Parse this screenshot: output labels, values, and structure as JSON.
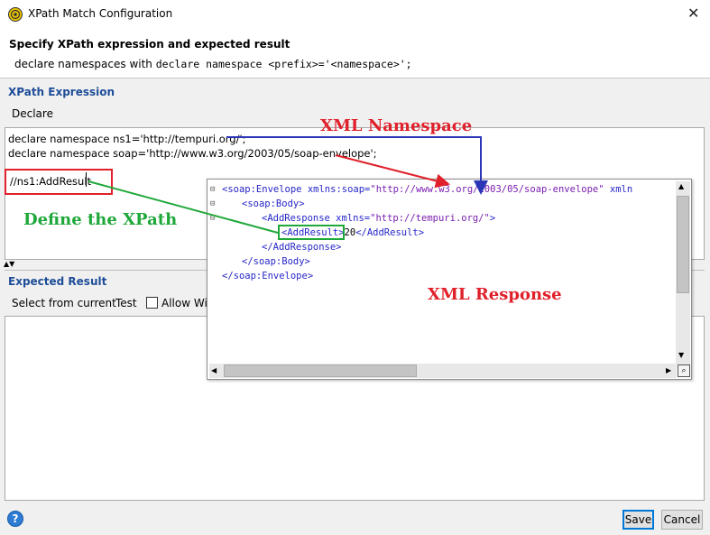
{
  "window": {
    "title": "XPath Match Configuration",
    "close_glyph": "✕"
  },
  "header": {
    "title": "Specify XPath expression and expected result",
    "desc_prefix": "declare namespaces with ",
    "desc_code": "declare namespace <prefix>='<namespace>';"
  },
  "xpath": {
    "section_label": "XPath Expression",
    "declare_label": "Declare",
    "lines": [
      "declare namespace ns1='http://tempuri.org/';",
      "declare namespace soap='http://www.w3.org/2003/05/soap-envelope';",
      "//ns1:AddResult"
    ]
  },
  "expected": {
    "section_label": "Expected Result",
    "toolbar": {
      "select_label": "Select from current",
      "test_label": "Test",
      "allow_label": "Allow Wil"
    }
  },
  "xml_panel": {
    "lines": [
      {
        "gutter": "⊟",
        "indent": 0,
        "parts": [
          [
            "tag",
            "<soap:Envelope"
          ],
          [
            "attr",
            " xmlns:soap="
          ],
          [
            "val",
            "\"http://www.w3.org/2003/05/soap-envelope\""
          ],
          [
            "attr",
            " xmln"
          ]
        ]
      },
      {
        "gutter": "⊟",
        "indent": 1,
        "parts": [
          [
            "tag",
            "<soap:Body>"
          ]
        ]
      },
      {
        "gutter": "⊟",
        "indent": 2,
        "parts": [
          [
            "tag",
            "<AddResponse"
          ],
          [
            "attr",
            " xmlns="
          ],
          [
            "val",
            "\"http://tempuri.org/\""
          ],
          [
            "tag",
            ">"
          ]
        ]
      },
      {
        "gutter": "",
        "indent": 3,
        "parts": [
          [
            "tag",
            "<AddResult>"
          ],
          [
            "plain",
            "20"
          ],
          [
            "tag",
            "</AddResult>"
          ]
        ]
      },
      {
        "gutter": "",
        "indent": 2,
        "parts": [
          [
            "tag",
            "</AddResponse>"
          ]
        ]
      },
      {
        "gutter": "",
        "indent": 1,
        "parts": [
          [
            "tag",
            "</soap:Body>"
          ]
        ]
      },
      {
        "gutter": "",
        "indent": 0,
        "parts": [
          [
            "tag",
            "</soap:Envelope>"
          ]
        ]
      }
    ]
  },
  "annotations": {
    "namespace": "XML Namespace",
    "define": "Define the XPath",
    "response": "XML Response"
  },
  "buttons": {
    "save": "Save",
    "cancel": "Cancel",
    "help": "?"
  },
  "colors": {
    "annotation_red": "#e0202a",
    "annotation_green": "#1fa83a",
    "annotation_blue": "#2b35b8",
    "section_blue": "#1f4e99"
  }
}
